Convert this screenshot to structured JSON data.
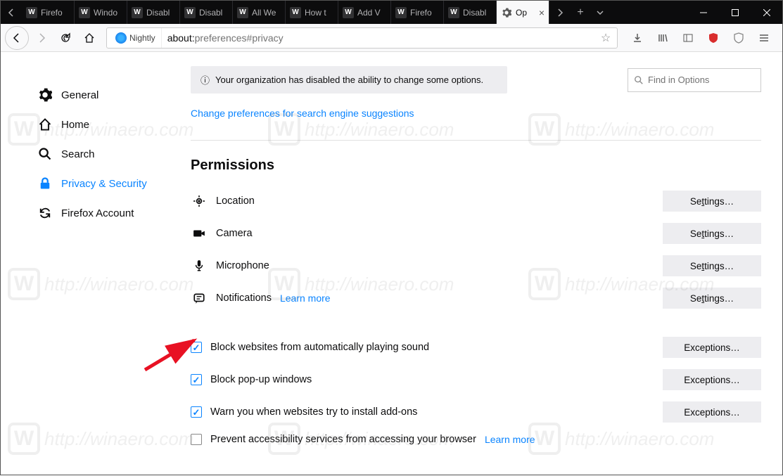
{
  "tabs": {
    "items": [
      {
        "label": "Firefo"
      },
      {
        "label": "Windo"
      },
      {
        "label": "Disabl"
      },
      {
        "label": "Disabl"
      },
      {
        "label": "All We"
      },
      {
        "label": "How t"
      },
      {
        "label": "Add V"
      },
      {
        "label": "Firefo"
      },
      {
        "label": "Disabl"
      }
    ],
    "active": {
      "label": "Op"
    }
  },
  "urlbar": {
    "identity": "Nightly",
    "url_prefix": "about:",
    "url_rest": "preferences#privacy"
  },
  "info_bar": "Your organization has disabled the ability to change some options.",
  "search_placeholder": "Find in Options",
  "sidebar": {
    "items": [
      {
        "label": "General"
      },
      {
        "label": "Home"
      },
      {
        "label": "Search"
      },
      {
        "label": "Privacy & Security"
      },
      {
        "label": "Firefox Account"
      }
    ]
  },
  "link_suggestions": "Change preferences for search engine suggestions",
  "permissions": {
    "title": "Permissions",
    "rows": [
      {
        "label": "Location",
        "button_pre": "Se",
        "button_ul": "t",
        "button_post": "tings…"
      },
      {
        "label": "Camera",
        "button_pre": "Se",
        "button_ul": "t",
        "button_post": "tings…"
      },
      {
        "label": "Microphone",
        "button_pre": "Se",
        "button_ul": "t",
        "button_post": "tings…"
      },
      {
        "label": "Notifications",
        "learn": "Learn more",
        "button_pre": "Se",
        "button_ul": "t",
        "button_post": "tings…"
      }
    ],
    "checks": [
      {
        "label": "Block websites from automatically playing sound",
        "checked": true,
        "button_pre": "",
        "button_ul": "E",
        "button_post": "xceptions…"
      },
      {
        "label": "Block pop-up windows",
        "checked": true,
        "button_pre": "",
        "button_ul": "E",
        "button_post": "xceptions…"
      },
      {
        "label": "Warn you when websites try to install add-ons",
        "checked": true,
        "button_pre": "",
        "button_ul": "E",
        "button_post": "xceptions…"
      },
      {
        "label": "Prevent accessibility services from accessing your browser",
        "checked": false,
        "learn": "Learn more"
      }
    ]
  },
  "watermark": "http://winaero.com"
}
